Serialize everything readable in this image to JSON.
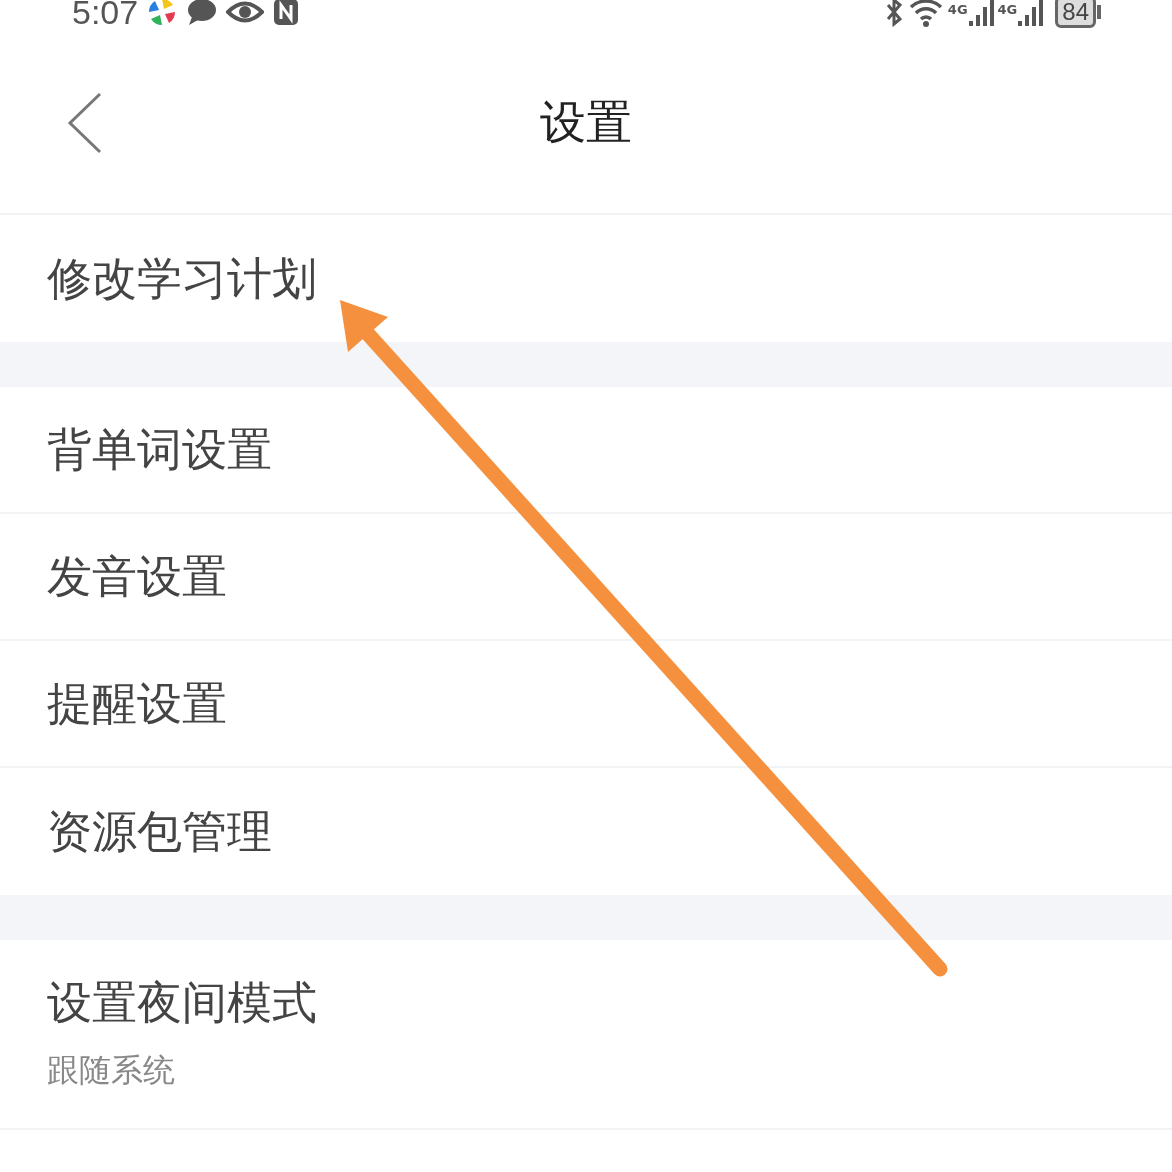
{
  "status_bar": {
    "time": "5:07",
    "network_labels": [
      "4G",
      "4G"
    ],
    "battery": "84"
  },
  "header": {
    "title": "设置"
  },
  "sections": [
    {
      "items": [
        {
          "label": "修改学习计划"
        }
      ]
    },
    {
      "items": [
        {
          "label": "背单词设置"
        },
        {
          "label": "发音设置"
        },
        {
          "label": "提醒设置"
        },
        {
          "label": "资源包管理"
        }
      ]
    },
    {
      "items": [
        {
          "label": "设置夜间模式",
          "subtitle": "跟随系统"
        }
      ]
    }
  ]
}
